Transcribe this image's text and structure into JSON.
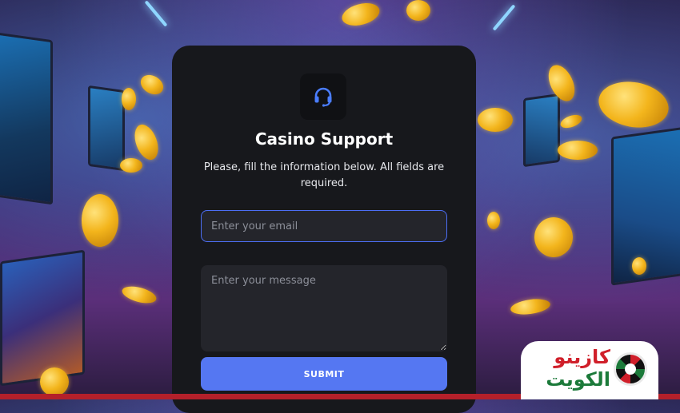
{
  "form": {
    "title": "Casino Support",
    "subtitle": "Please, fill the information below. All fields are required.",
    "email_placeholder": "Enter your email",
    "message_placeholder": "Enter your message",
    "submit_label": "SUBMIT",
    "logo_icon": "headset-icon"
  },
  "brand": {
    "line1": "كازينو",
    "line2": "الكويت"
  },
  "colors": {
    "accent": "#5577f2",
    "card": "#17181c",
    "brand_red": "#d01f2a",
    "brand_green": "#1c7a3a"
  }
}
